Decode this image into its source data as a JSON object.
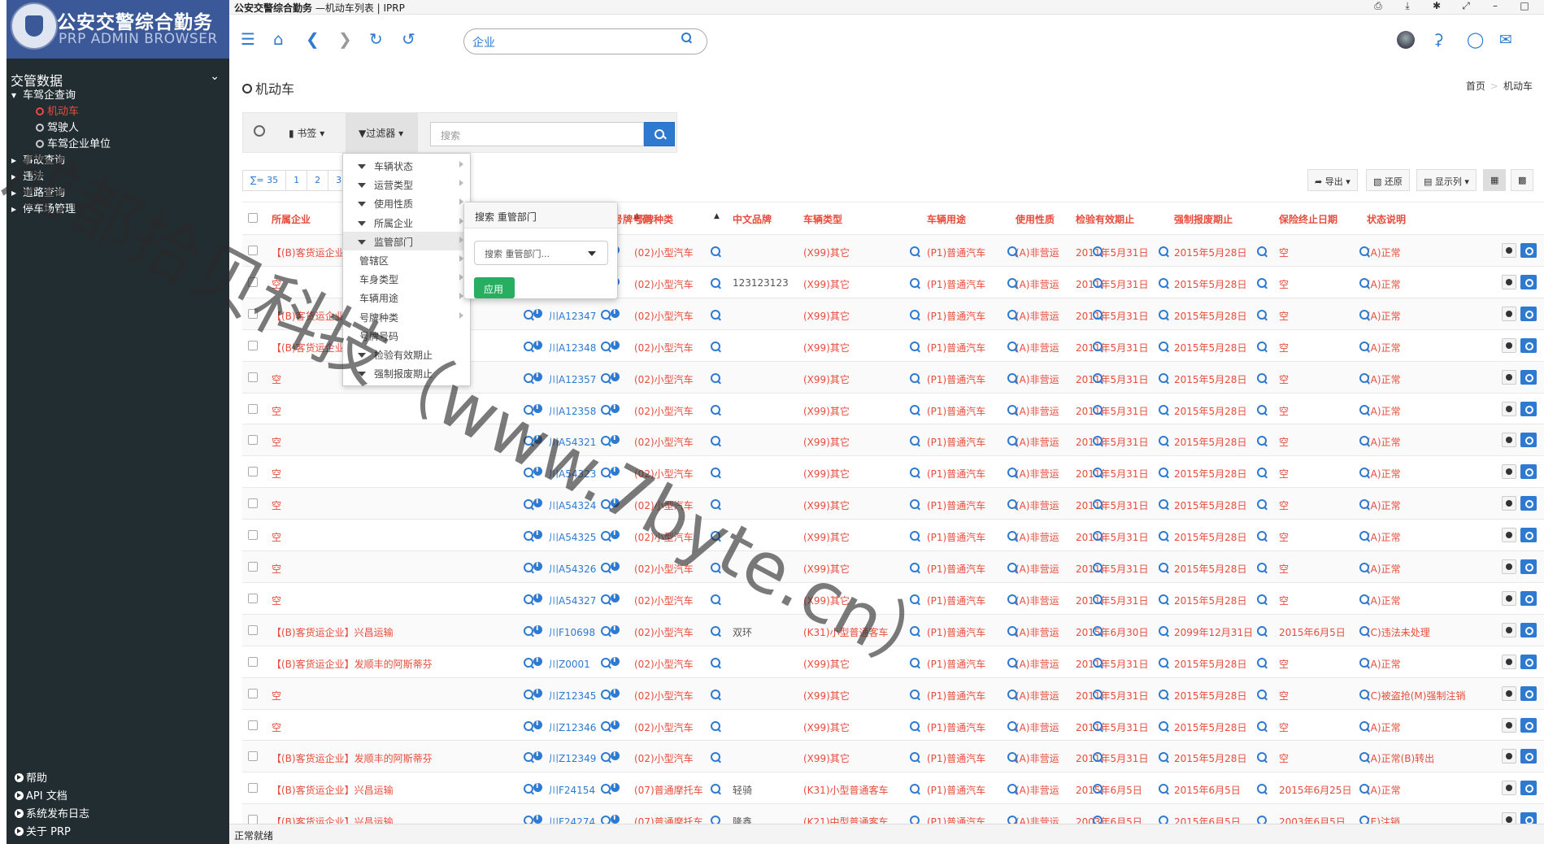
{
  "sidebar": {
    "logo_title": "公安交警综合勤务",
    "logo_subtitle": "PRP ADMIN BROWSER",
    "section_title": "交管数据",
    "tree": [
      {
        "label": "车驾企查询"
      },
      {
        "label": "事故查询"
      },
      {
        "label": "违法"
      },
      {
        "label": "道路查询"
      },
      {
        "label": "停车场管理"
      }
    ],
    "sub_items": [
      {
        "label": "机动车"
      },
      {
        "label": "驾驶人"
      },
      {
        "label": "车驾企业单位"
      }
    ],
    "footer": [
      {
        "label": "帮助"
      },
      {
        "label": "API 文档"
      },
      {
        "label": "系统发布日志"
      },
      {
        "label": "关于 PRP"
      }
    ]
  },
  "window": {
    "app": "公安交警综合勤务",
    "title_rest": " —机动车列表 | IPRP"
  },
  "toolbar": {
    "address": "企业"
  },
  "page": {
    "title": "机动车",
    "breadcrumb": [
      "首页",
      "机动车"
    ]
  },
  "filterbar": {
    "bookmark": "书签",
    "filter": "过滤器",
    "search_placeholder": "搜索"
  },
  "pager": {
    "total": "∑= 35",
    "pages": [
      "1",
      "2",
      "3"
    ]
  },
  "table_tools": {
    "export": "导出",
    "restore": "还原",
    "columns": "显示列"
  },
  "filter_menu": [
    "车辆状态",
    "运营类型",
    "使用性质",
    "所属企业",
    "监管部门",
    "管辖区",
    "车身类型",
    "车辆用途",
    "号牌种类",
    "号牌号码",
    "检验有效期止",
    "强制报废期止"
  ],
  "filter_pop": {
    "title": "搜索 重管部门",
    "select": "搜索 重管部门...",
    "apply": "应用"
  },
  "columns": [
    "所属企业",
    "号牌号码",
    "号牌种类",
    "中文品牌",
    "车辆类型",
    "车辆用途",
    "使用性质",
    "检验有效期止",
    "强制报废期止",
    "保险终止日期",
    "状态说明"
  ],
  "rows": [
    {
      "company": "【(B)客货运企业】",
      "plate": "川A12345",
      "ptype": "(02)小型汽车",
      "brand": "",
      "vtype": "(X99)其它",
      "use": "(P1)普通汽车",
      "nature": "(A)非营运",
      "insp": "2011年5月31日",
      "scrap": "2015年5月28日",
      "ins": "空",
      "status": "(A)正常"
    },
    {
      "company": "空",
      "plate": "川A12346",
      "ptype": "(02)小型汽车",
      "brand": "123123123",
      "vtype": "(X99)其它",
      "use": "(P1)普通汽车",
      "nature": "(A)非营运",
      "insp": "2011年5月31日",
      "scrap": "2015年5月28日",
      "ins": "空",
      "status": "(A)正常"
    },
    {
      "company": "【(B)客货运企业】",
      "plate": "川A12347",
      "ptype": "(02)小型汽车",
      "brand": "",
      "vtype": "(X99)其它",
      "use": "(P1)普通汽车",
      "nature": "(A)非营运",
      "insp": "2011年5月31日",
      "scrap": "2015年5月28日",
      "ins": "空",
      "status": "(A)正常"
    },
    {
      "company": "【(B)客货运企业】",
      "plate": "川A12348",
      "ptype": "(02)小型汽车",
      "brand": "",
      "vtype": "(X99)其它",
      "use": "(P1)普通汽车",
      "nature": "(A)非营运",
      "insp": "2011年5月31日",
      "scrap": "2015年5月28日",
      "ins": "空",
      "status": "(A)正常"
    },
    {
      "company": "空",
      "plate": "川A12357",
      "ptype": "(02)小型汽车",
      "brand": "",
      "vtype": "(X99)其它",
      "use": "(P1)普通汽车",
      "nature": "(A)非营运",
      "insp": "2011年5月31日",
      "scrap": "2015年5月28日",
      "ins": "空",
      "status": "(A)正常"
    },
    {
      "company": "空",
      "plate": "川A12358",
      "ptype": "(02)小型汽车",
      "brand": "",
      "vtype": "(X99)其它",
      "use": "(P1)普通汽车",
      "nature": "(A)非营运",
      "insp": "2011年5月31日",
      "scrap": "2015年5月28日",
      "ins": "空",
      "status": "(A)正常"
    },
    {
      "company": "空",
      "plate": "川A54321",
      "ptype": "(02)小型汽车",
      "brand": "",
      "vtype": "(X99)其它",
      "use": "(P1)普通汽车",
      "nature": "(A)非营运",
      "insp": "2011年5月31日",
      "scrap": "2015年5月28日",
      "ins": "空",
      "status": "(A)正常"
    },
    {
      "company": "空",
      "plate": "川A54323",
      "ptype": "(02)小型汽车",
      "brand": "",
      "vtype": "(X99)其它",
      "use": "(P1)普通汽车",
      "nature": "(A)非营运",
      "insp": "2011年5月31日",
      "scrap": "2015年5月28日",
      "ins": "空",
      "status": "(A)正常"
    },
    {
      "company": "空",
      "plate": "川A54324",
      "ptype": "(02)小型汽车",
      "brand": "",
      "vtype": "(X99)其它",
      "use": "(P1)普通汽车",
      "nature": "(A)非营运",
      "insp": "2011年5月31日",
      "scrap": "2015年5月28日",
      "ins": "空",
      "status": "(A)正常"
    },
    {
      "company": "空",
      "plate": "川A54325",
      "ptype": "(02)小型汽车",
      "brand": "",
      "vtype": "(X99)其它",
      "use": "(P1)普通汽车",
      "nature": "(A)非营运",
      "insp": "2011年5月31日",
      "scrap": "2015年5月28日",
      "ins": "空",
      "status": "(A)正常"
    },
    {
      "company": "空",
      "plate": "川A54326",
      "ptype": "(02)小型汽车",
      "brand": "",
      "vtype": "(X99)其它",
      "use": "(P1)普通汽车",
      "nature": "(A)非营运",
      "insp": "2011年5月31日",
      "scrap": "2015年5月28日",
      "ins": "空",
      "status": "(A)正常"
    },
    {
      "company": "空",
      "plate": "川A54327",
      "ptype": "(02)小型汽车",
      "brand": "",
      "vtype": "(X99)其它",
      "use": "(P1)普通汽车",
      "nature": "(A)非营运",
      "insp": "2011年5月31日",
      "scrap": "2015年5月28日",
      "ins": "空",
      "status": "(A)正常"
    },
    {
      "company": "【(B)客货运企业】兴昌运输",
      "plate": "川F10698",
      "ptype": "(02)小型汽车",
      "brand": "双环",
      "vtype": "(K31)小型普通客车",
      "use": "(P1)普通汽车",
      "nature": "(A)非营运",
      "insp": "2015年6月30日",
      "scrap": "2099年12月31日",
      "ins": "2015年6月5日",
      "status": "(C)违法未处理"
    },
    {
      "company": "【(B)客货运企业】发顺丰的阿斯蒂芬",
      "plate": "川Z0001",
      "ptype": "(02)小型汽车",
      "brand": "",
      "vtype": "(X99)其它",
      "use": "(P1)普通汽车",
      "nature": "(A)非营运",
      "insp": "2011年5月31日",
      "scrap": "2015年5月28日",
      "ins": "空",
      "status": "(A)正常"
    },
    {
      "company": "空",
      "plate": "川Z12345",
      "ptype": "(02)小型汽车",
      "brand": "",
      "vtype": "(X99)其它",
      "use": "(P1)普通汽车",
      "nature": "(A)非营运",
      "insp": "2011年5月31日",
      "scrap": "2015年5月28日",
      "ins": "空",
      "status": "(C)被盗抢(M)强制注销"
    },
    {
      "company": "空",
      "plate": "川Z12346",
      "ptype": "(02)小型汽车",
      "brand": "",
      "vtype": "(X99)其它",
      "use": "(P1)普通汽车",
      "nature": "(A)非营运",
      "insp": "2011年5月31日",
      "scrap": "2015年5月28日",
      "ins": "空",
      "status": "(A)正常"
    },
    {
      "company": "【(B)客货运企业】发顺丰的阿斯蒂芬",
      "plate": "川Z12349",
      "ptype": "(02)小型汽车",
      "brand": "",
      "vtype": "(X99)其它",
      "use": "(P1)普通汽车",
      "nature": "(A)非营运",
      "insp": "2011年5月31日",
      "scrap": "2015年5月28日",
      "ins": "空",
      "status": "(A)正常(B)转出"
    },
    {
      "company": "【(B)客货运企业】兴昌运输",
      "plate": "川F24154",
      "ptype": "(07)普通摩托车",
      "brand": "轻骑",
      "vtype": "(K31)小型普通客车",
      "use": "(P1)普通汽车",
      "nature": "(A)非营运",
      "insp": "2015年6月5日",
      "scrap": "2015年6月5日",
      "ins": "2015年6月25日",
      "status": "(A)正常"
    },
    {
      "company": "【(B)客货运企业】兴昌运输",
      "plate": "川F24274",
      "ptype": "(07)普通摩托车",
      "brand": "隆鑫",
      "vtype": "(K21)中型普通客车",
      "use": "(P1)普通汽车",
      "nature": "(A)非营运",
      "insp": "2003年6月5日",
      "scrap": "2015年6月5日",
      "ins": "2003年6月5日",
      "status": "(E)注销"
    }
  ],
  "status_bar": "正常就绪",
  "watermark": "成都拾贝科技（www.7byte.cn）",
  "colors": {
    "sidebar": "#222d32",
    "logo_bg": "#3b5998",
    "accent": "#2e7ad1",
    "link_red": "#e74c3c",
    "apply_green": "#27ae60"
  }
}
